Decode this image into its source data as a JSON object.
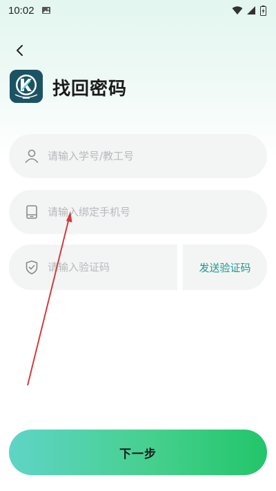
{
  "status_bar": {
    "time": "10:02",
    "icons": [
      "image-icon",
      "wifi-icon",
      "signal-icon",
      "battery-charging-icon"
    ]
  },
  "header": {
    "back_icon": "chevron-left-icon",
    "title": "找回密码"
  },
  "form": {
    "account": {
      "placeholder": "请输入学号/教工号",
      "value": "",
      "icon": "user-icon"
    },
    "phone": {
      "placeholder": "请输入绑定手机号",
      "value": "",
      "icon": "phone-icon"
    },
    "code": {
      "placeholder": "请输入验证码",
      "value": "",
      "icon": "shield-check-icon"
    },
    "send_code_label": "发送验证码"
  },
  "actions": {
    "next_label": "下一步"
  },
  "colors": {
    "accent": "#1a9a8c",
    "button_gradient_start": "#5fd4c7",
    "button_gradient_end": "#22c56a",
    "annotation": "#d23a3a"
  }
}
